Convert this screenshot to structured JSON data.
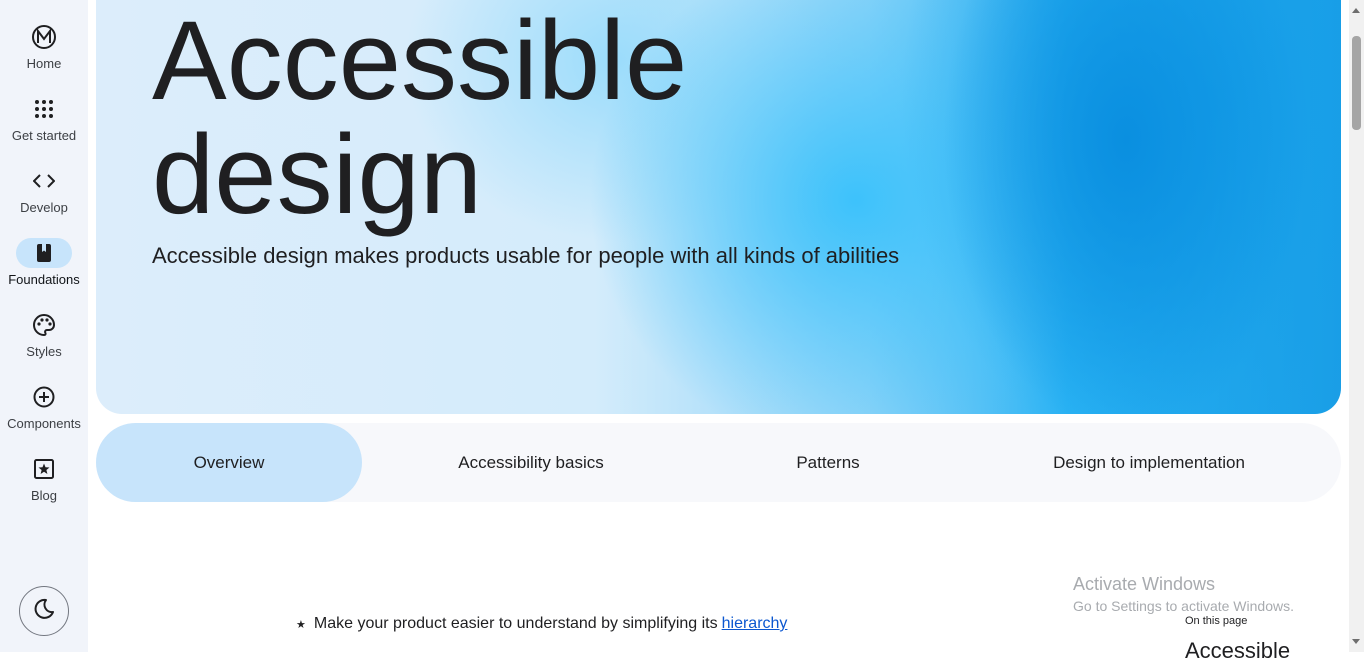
{
  "nav": {
    "items": [
      {
        "label": "Home",
        "icon": "material-logo-icon"
      },
      {
        "label": "Get started",
        "icon": "apps-grid-icon"
      },
      {
        "label": "Develop",
        "icon": "code-icon"
      },
      {
        "label": "Foundations",
        "icon": "book-icon",
        "active": true
      },
      {
        "label": "Styles",
        "icon": "palette-icon"
      },
      {
        "label": "Components",
        "icon": "add-circle-icon"
      },
      {
        "label": "Blog",
        "icon": "star-box-icon"
      }
    ],
    "theme_icon": "dark-mode-moon-icon"
  },
  "hero": {
    "title_line1": "Accessible",
    "title_line2": "design",
    "subtitle": "Accessible design makes products usable for people with all kinds of abilities"
  },
  "tabs": [
    {
      "label": "Overview",
      "active": true
    },
    {
      "label": "Accessibility basics"
    },
    {
      "label": "Patterns"
    },
    {
      "label": "Design to implementation"
    }
  ],
  "content": {
    "bullet_text": "Make your product easier to understand by simplifying its",
    "bullet_link": "hierarchy"
  },
  "toc": {
    "heading": "On this page",
    "first_item": "Accessible"
  },
  "watermark": {
    "title": "Activate Windows",
    "subtitle": "Go to Settings to activate Windows."
  },
  "colors": {
    "accent": "#c7e4fb",
    "rail_bg": "#f1f4fa",
    "link": "#0b57d0"
  }
}
